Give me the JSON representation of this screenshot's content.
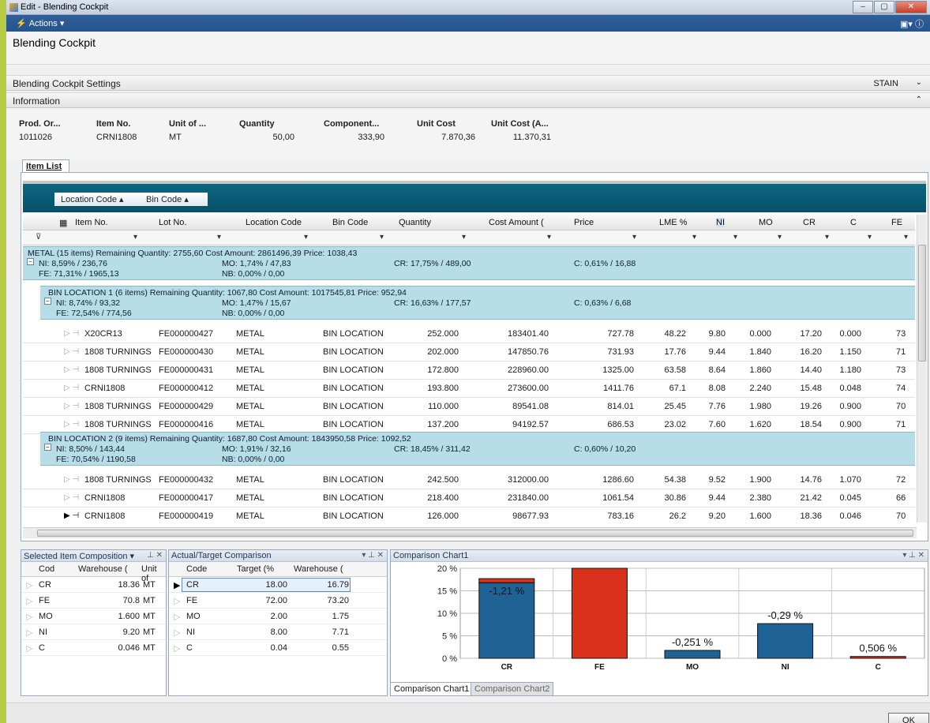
{
  "window": {
    "title": "Edit - Blending Cockpit"
  },
  "actions_label": "Actions",
  "page_title": "Blending Cockpit",
  "settings_section": {
    "label": "Blending Cockpit Settings",
    "value": "STAIN"
  },
  "info_section": {
    "label": "Information"
  },
  "info_fields": [
    {
      "label": "Prod. Or...",
      "value": "1011026"
    },
    {
      "label": "Item No.",
      "value": "CRNI1808"
    },
    {
      "label": "Unit of ...",
      "value": "MT"
    },
    {
      "label": "Quantity",
      "value": "50,00"
    },
    {
      "label": "Component...",
      "value": "333,90"
    },
    {
      "label": "Unit Cost",
      "value": "7.870,36"
    },
    {
      "label": "Unit Cost (A...",
      "value": "11.370,31"
    }
  ],
  "item_list_tab": "Item List",
  "group_pills": [
    "Location Code",
    "Bin Code"
  ],
  "columns": [
    "Item No.",
    "Lot No.",
    "Location Code",
    "Bin Code",
    "Quantity",
    "Cost Amount (",
    "Price",
    "LME %",
    "NI",
    "MO",
    "CR",
    "C",
    "FE"
  ],
  "metal_group": {
    "line1": "METAL (15 items) Remaining Quantity: 2755,60 Cost Amount: 2861496,39 Price: 1038,43",
    "ni": "NI: 8,59% / 236,76",
    "mo": "MO: 1,74% / 47,83",
    "cr": "CR: 17,75% / 489,00",
    "c": "C: 0,61% / 16,88",
    "fe": "FE: 71,31% / 1965,13",
    "nb": "NB: 0,00% / 0,00"
  },
  "bin1_group": {
    "line1": "BIN LOCATION 1 (6 items) Remaining Quantity: 1067,80 Cost Amount: 1017545,81 Price: 952,94",
    "ni": "NI: 8,74% / 93,32",
    "mo": "MO: 1,47% / 15,67",
    "cr": "CR: 16,63% / 177,57",
    "c": "C: 0,63% / 6,68",
    "fe": "FE: 72,54% / 774,56",
    "nb": "NB: 0,00% / 0,00"
  },
  "bin2_group": {
    "line1": "BIN LOCATION 2 (9 items) Remaining Quantity: 1687,80 Cost Amount: 1843950,58 Price: 1092,52",
    "ni": "NI: 8,50% / 143,44",
    "mo": "MO: 1,91% / 32,16",
    "cr": "CR: 18,45% / 311,42",
    "c": "C: 0,60% / 10,20",
    "fe": "FE: 70,54% / 1190,58",
    "nb": "NB: 0,00% / 0,00"
  },
  "bin1_rows": [
    {
      "item": "X20CR13",
      "lot": "FE000000427",
      "loc": "METAL",
      "bin": "BIN LOCATION",
      "qty": "252.000",
      "cost": "183401.40",
      "price": "727.78",
      "lme": "48.22",
      "ni": "9.80",
      "mo": "0.000",
      "cr": "17.20",
      "c": "0.000",
      "fe": "73"
    },
    {
      "item": "1808 TURNINGS",
      "lot": "FE000000430",
      "loc": "METAL",
      "bin": "BIN LOCATION",
      "qty": "202.000",
      "cost": "147850.76",
      "price": "731.93",
      "lme": "17.76",
      "ni": "9.44",
      "mo": "1.840",
      "cr": "16.20",
      "c": "1.150",
      "fe": "71"
    },
    {
      "item": "1808 TURNINGS",
      "lot": "FE000000431",
      "loc": "METAL",
      "bin": "BIN LOCATION",
      "qty": "172.800",
      "cost": "228960.00",
      "price": "1325.00",
      "lme": "63.58",
      "ni": "8.64",
      "mo": "1.860",
      "cr": "14.40",
      "c": "1.180",
      "fe": "73"
    },
    {
      "item": "CRNI1808",
      "lot": "FE000000412",
      "loc": "METAL",
      "bin": "BIN LOCATION",
      "qty": "193.800",
      "cost": "273600.00",
      "price": "1411.76",
      "lme": "67.1",
      "ni": "8.08",
      "mo": "2.240",
      "cr": "15.48",
      "c": "0.048",
      "fe": "74"
    },
    {
      "item": "1808 TURNINGS",
      "lot": "FE000000429",
      "loc": "METAL",
      "bin": "BIN LOCATION",
      "qty": "110.000",
      "cost": "89541.08",
      "price": "814.01",
      "lme": "25.45",
      "ni": "7.76",
      "mo": "1.980",
      "cr": "19.26",
      "c": "0.900",
      "fe": "70"
    },
    {
      "item": "1808 TURNINGS",
      "lot": "FE000000416",
      "loc": "METAL",
      "bin": "BIN LOCATION",
      "qty": "137.200",
      "cost": "94192.57",
      "price": "686.53",
      "lme": "23.02",
      "ni": "7.60",
      "mo": "1.620",
      "cr": "18.54",
      "c": "0.900",
      "fe": "71"
    }
  ],
  "bin2_rows": [
    {
      "item": "1808 TURNINGS",
      "lot": "FE000000432",
      "loc": "METAL",
      "bin": "BIN LOCATION",
      "qty": "242.500",
      "cost": "312000.00",
      "price": "1286.60",
      "lme": "54.38",
      "ni": "9.52",
      "mo": "1.900",
      "cr": "14.76",
      "c": "1.070",
      "fe": "72"
    },
    {
      "item": "CRNI1808",
      "lot": "FE000000417",
      "loc": "METAL",
      "bin": "BIN LOCATION",
      "qty": "218.400",
      "cost": "231840.00",
      "price": "1061.54",
      "lme": "30.86",
      "ni": "9.44",
      "mo": "2.380",
      "cr": "21.42",
      "c": "0.045",
      "fe": "66"
    },
    {
      "item": "CRNI1808",
      "lot": "FE000000419",
      "loc": "METAL",
      "bin": "BIN LOCATION",
      "qty": "126.000",
      "cost": "98677.93",
      "price": "783.16",
      "lme": "26.2",
      "ni": "9.20",
      "mo": "1.600",
      "cr": "18.36",
      "c": "0.046",
      "fe": "70"
    }
  ],
  "composition_panel": {
    "title": "Selected Item Composition",
    "headers": [
      "Cod",
      "Warehouse (",
      "Unit of"
    ],
    "rows": [
      {
        "code": "CR",
        "val": "18.36",
        "unit": "MT"
      },
      {
        "code": "FE",
        "val": "70.8",
        "unit": "MT"
      },
      {
        "code": "MO",
        "val": "1.600",
        "unit": "MT"
      },
      {
        "code": "NI",
        "val": "9.20",
        "unit": "MT"
      },
      {
        "code": "C",
        "val": "0.046",
        "unit": "MT"
      }
    ]
  },
  "comparison_panel": {
    "title": "Actual/Target Comparison",
    "headers": [
      "Code",
      "Target (%",
      "Warehouse ("
    ],
    "rows": [
      {
        "code": "CR",
        "target": "18.00",
        "wh": "16.79"
      },
      {
        "code": "FE",
        "target": "72.00",
        "wh": "73.20"
      },
      {
        "code": "MO",
        "target": "2.00",
        "wh": "1.75"
      },
      {
        "code": "NI",
        "target": "8.00",
        "wh": "7.71"
      },
      {
        "code": "C",
        "target": "0.04",
        "wh": "0.55"
      }
    ]
  },
  "chart_panel": {
    "title": "Comparison Chart1",
    "tabs": [
      "Comparison Chart1",
      "Comparison Chart2"
    ]
  },
  "chart_data": {
    "type": "bar",
    "categories": [
      "CR",
      "FE",
      "MO",
      "NI",
      "C"
    ],
    "series": [
      {
        "values": [
          16.8,
          0,
          1.75,
          7.7,
          0
        ]
      },
      {
        "values": [
          0.9,
          20,
          0,
          0,
          0.4
        ]
      }
    ],
    "labels": [
      "-1,21 %",
      "",
      "-0,251 %",
      "-0,29 %",
      "0,506 %"
    ],
    "ticks": [
      "0 %",
      "5 %",
      "10 %",
      "15 %",
      "20 %"
    ],
    "ylim": [
      0,
      20
    ],
    "colors": {
      "actual": "#1f6394",
      "diff": "#d9311c"
    }
  },
  "ok_label": "OK"
}
